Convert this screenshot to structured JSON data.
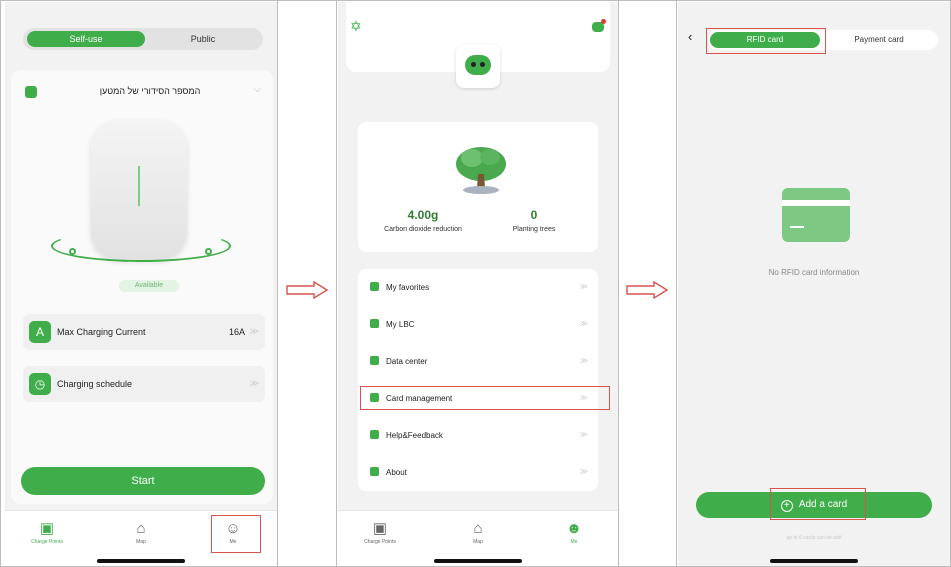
{
  "screen1": {
    "segment": {
      "active": "Self-use",
      "inactive": "Public"
    },
    "serial_label": "המספר הסידורי של המטען",
    "status": "Available",
    "max_current": {
      "icon_letter": "A",
      "label": "Max Charging Current",
      "value": "16A"
    },
    "schedule": {
      "label": "Charging schedule"
    },
    "start_label": "Start",
    "tabs": [
      "Charge Points",
      "Map",
      "Me"
    ]
  },
  "screen2": {
    "carbon": {
      "value": "4.00g",
      "label": "Carbon dioxide reduction"
    },
    "trees": {
      "value": "0",
      "label": "Planting trees"
    },
    "menu": [
      "My favorites",
      "My LBC",
      "Data center",
      "Card management",
      "Help&Feedback",
      "About"
    ],
    "tabs": [
      "Charge Points",
      "Map",
      "Me"
    ]
  },
  "screen3": {
    "tab_active": "RFID card",
    "tab_inactive": "Payment card",
    "empty_text": "No RFID card information",
    "add_button": "Add a card",
    "limit_note": "up to 6 cards can be add"
  },
  "colors": {
    "accent": "#3fae4a",
    "highlight": "#d9534f"
  }
}
